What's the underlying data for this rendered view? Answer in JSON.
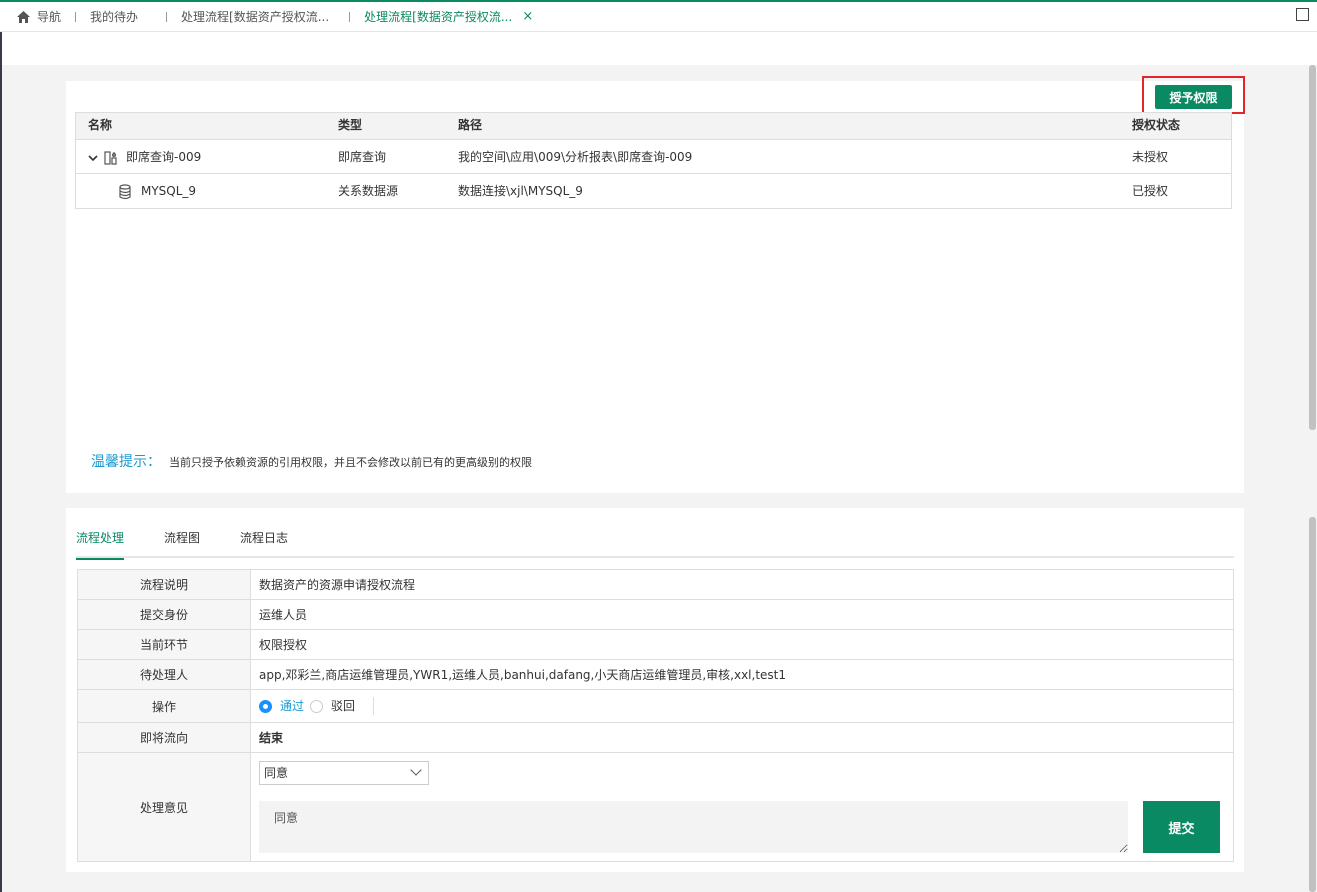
{
  "tabbar": {
    "tabs": [
      {
        "label": "导航",
        "icon": "home-icon"
      },
      {
        "label": "我的待办"
      },
      {
        "label": "处理流程[数据资产授权流..."
      },
      {
        "label": "处理流程[数据资产授权流...",
        "active": true,
        "close": "×"
      }
    ]
  },
  "panel": {
    "grant_button": "授予权限",
    "table": {
      "headers": [
        "名称",
        "类型",
        "路径",
        "授权状态"
      ],
      "rows": [
        {
          "name": "即席查询-009",
          "type": "即席查询",
          "path": "我的空间\\应用\\009\\分析报表\\即席查询-009",
          "status": "未授权",
          "icon": "adhoc-query-icon",
          "expanded": true
        },
        {
          "name": "MYSQL_9",
          "type": "关系数据源",
          "path": "数据连接\\xjl\\MYSQL_9",
          "status": "已授权",
          "icon": "database-icon"
        }
      ]
    },
    "tip_label": "温馨提示：",
    "tip_text": "当前只授予依赖资源的引用权限，并且不会修改以前已有的更高级别的权限"
  },
  "process": {
    "tabs": [
      "流程处理",
      "流程图",
      "流程日志"
    ],
    "active_tab": "流程处理",
    "fields": {
      "desc_label": "流程说明",
      "desc_value": "数据资产的资源申请授权流程",
      "identity_label": "提交身份",
      "identity_value": "运维人员",
      "stage_label": "当前环节",
      "stage_value": "权限授权",
      "handler_label": "待处理人",
      "handler_value": "app,邓彩兰,商店运维管理员,YWR1,运维人员,banhui,dafang,小天商店运维管理员,审核,xxl,test1",
      "action_label": "操作",
      "action_pass": "通过",
      "action_reject": "驳回",
      "next_label": "即将流向",
      "next_value": "结束",
      "opinion_label": "处理意见",
      "opinion_select": "同意",
      "opinion_text": "同意"
    },
    "submit_label": "提交"
  },
  "colors": {
    "accent": "#0a8a63",
    "tip": "#1b9bd1",
    "highlight": "#e3262b"
  }
}
